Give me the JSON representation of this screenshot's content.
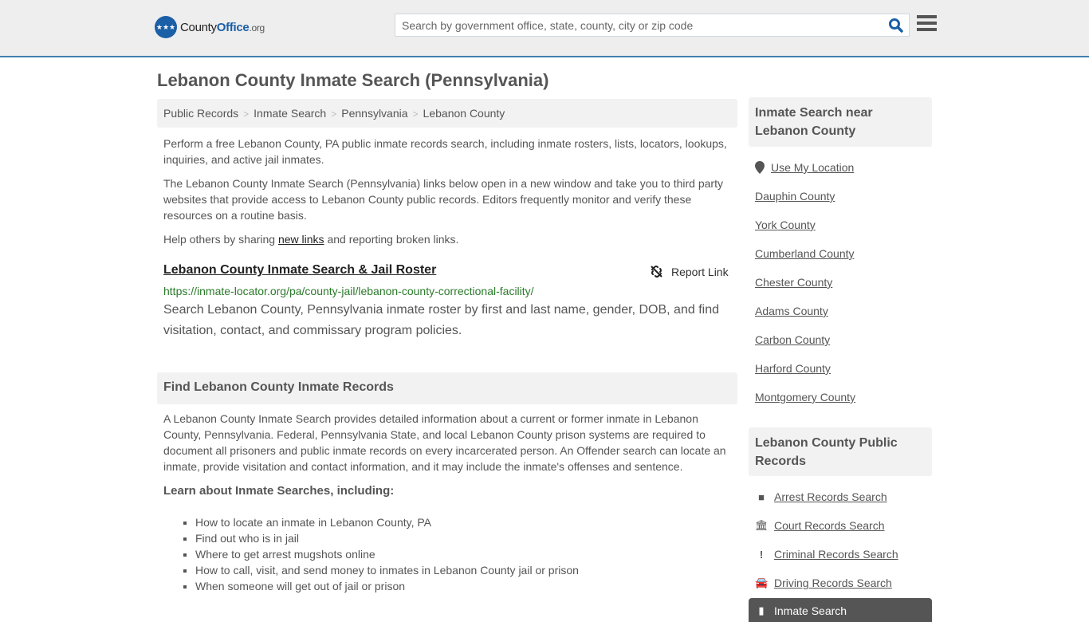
{
  "header": {
    "logo": {
      "county": "County",
      "office": "Office",
      "org": ".org"
    },
    "search_placeholder": "Search by government office, state, county, city or zip code"
  },
  "page_title": "Lebanon County Inmate Search (Pennsylvania)",
  "breadcrumb": [
    "Public Records",
    "Inmate Search",
    "Pennsylvania",
    "Lebanon County"
  ],
  "intro": {
    "p1": "Perform a free Lebanon County, PA public inmate records search, including inmate rosters, lists, locators, lookups, inquiries, and active jail inmates.",
    "p2": "The Lebanon County Inmate Search (Pennsylvania) links below open in a new window and take you to third party websites that provide access to Lebanon County public records. Editors frequently monitor and verify these resources on a routine basis.",
    "p3_before": "Help others by sharing ",
    "p3_link": "new links",
    "p3_after": " and reporting broken links."
  },
  "result": {
    "title": "Lebanon County Inmate Search & Jail Roster",
    "report_label": "Report Link",
    "url": "https://inmate-locator.org/pa/county-jail/lebanon-county-correctional-facility/",
    "description": "Search Lebanon County, Pennsylvania inmate roster by first and last name, gender, DOB, and find visitation, contact, and commissary program policies."
  },
  "find_section": {
    "heading": "Find Lebanon County Inmate Records",
    "body": "A Lebanon County Inmate Search provides detailed information about a current or former inmate in Lebanon County, Pennsylvania. Federal, Pennsylvania State, and local Lebanon County prison systems are required to document all prisoners and public inmate records on every incarcerated person. An Offender search can locate an inmate, provide visitation and contact information, and it may include the inmate's offenses and sentence.",
    "learn_heading": "Learn about Inmate Searches, including:",
    "bullets": [
      "How to locate an inmate in Lebanon County, PA",
      "Find out who is in jail",
      "Where to get arrest mugshots online",
      "How to call, visit, and send money to inmates in Lebanon County jail or prison",
      "When someone will get out of jail or prison"
    ]
  },
  "sidebar": {
    "nearby_heading": "Inmate Search near Lebanon County",
    "use_location": "Use My Location",
    "nearby": [
      "Dauphin County",
      "York County",
      "Cumberland County",
      "Chester County",
      "Adams County",
      "Carbon County",
      "Harford County",
      "Montgomery County"
    ],
    "records_heading": "Lebanon County Public Records",
    "records": [
      {
        "label": "Arrest Records Search",
        "icon": "arrest-icon"
      },
      {
        "label": "Court Records Search",
        "icon": "courthouse-icon"
      },
      {
        "label": "Criminal Records Search",
        "icon": "exclamation-icon"
      },
      {
        "label": "Driving Records Search",
        "icon": "car-icon"
      }
    ],
    "active_item": "Inmate Search"
  }
}
